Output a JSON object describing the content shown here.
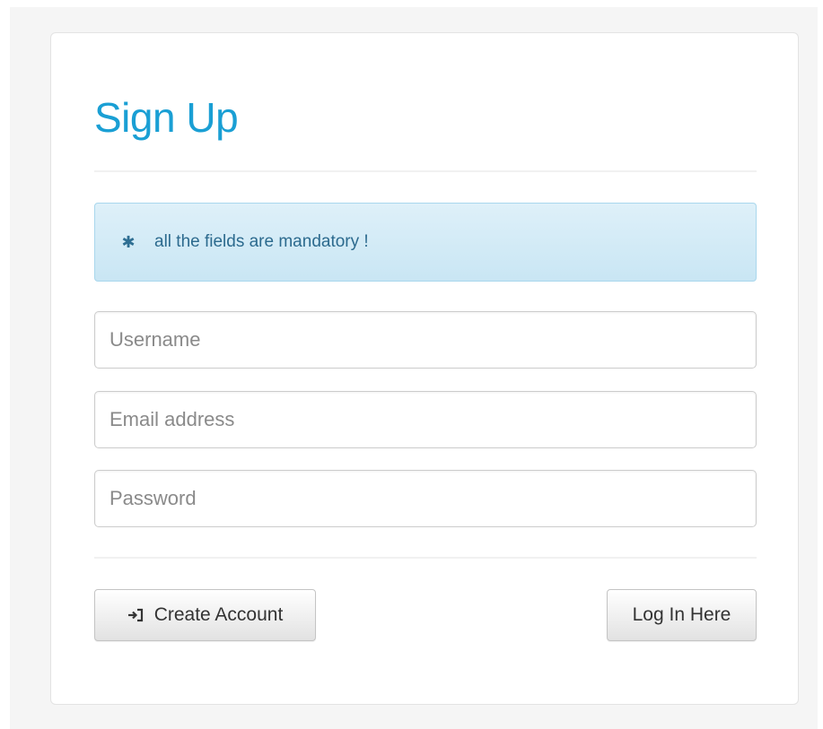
{
  "form": {
    "title": "Sign Up",
    "alert": {
      "icon": "asterisk-icon",
      "text": "all the fields are mandatory !"
    },
    "fields": {
      "username": {
        "value": "",
        "placeholder": "Username"
      },
      "email": {
        "value": "",
        "placeholder": "Email address"
      },
      "password": {
        "value": "",
        "placeholder": "Password"
      }
    },
    "buttons": {
      "create_account": {
        "label": "Create Account",
        "icon": "sign-in-icon"
      },
      "log_in": {
        "label": "Log In Here"
      }
    }
  },
  "colors": {
    "title": "#1a9fd4",
    "alert_background": "#d6ecf7",
    "alert_text": "#2c6a8e"
  }
}
